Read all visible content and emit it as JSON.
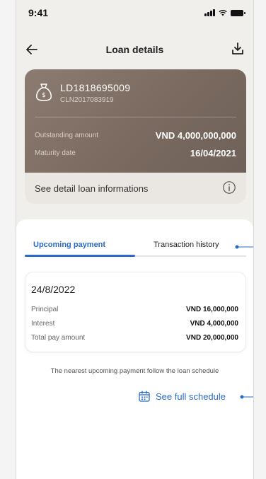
{
  "status_bar": {
    "time": "9:41"
  },
  "header": {
    "title": "Loan details"
  },
  "loan_card": {
    "loan_id": "LD1818695009",
    "cln": "CLN2017083919",
    "outstanding_label": "Outstanding amount",
    "outstanding_value": "VND 4,000,000,000",
    "maturity_label": "Maturity date",
    "maturity_value": "16/04/2021",
    "detail_link": "See detail loan informations"
  },
  "tabs": [
    {
      "label": "Upcoming payment",
      "active": true
    },
    {
      "label": "Transaction history",
      "active": false
    }
  ],
  "payment": {
    "date": "24/8/2022",
    "rows": [
      {
        "label": "Principal",
        "value": "VND 16,000,000"
      },
      {
        "label": "Interest",
        "value": "VND 4,000,000"
      },
      {
        "label": "Total pay amount",
        "value": "VND 20,000,000"
      }
    ]
  },
  "note": "The nearest upcoming payment follow the loan schedule",
  "schedule_link": "See full schedule",
  "colors": {
    "accent": "#2a6ac7",
    "card_brown": "#7a6a60",
    "background": "#f1efec"
  }
}
